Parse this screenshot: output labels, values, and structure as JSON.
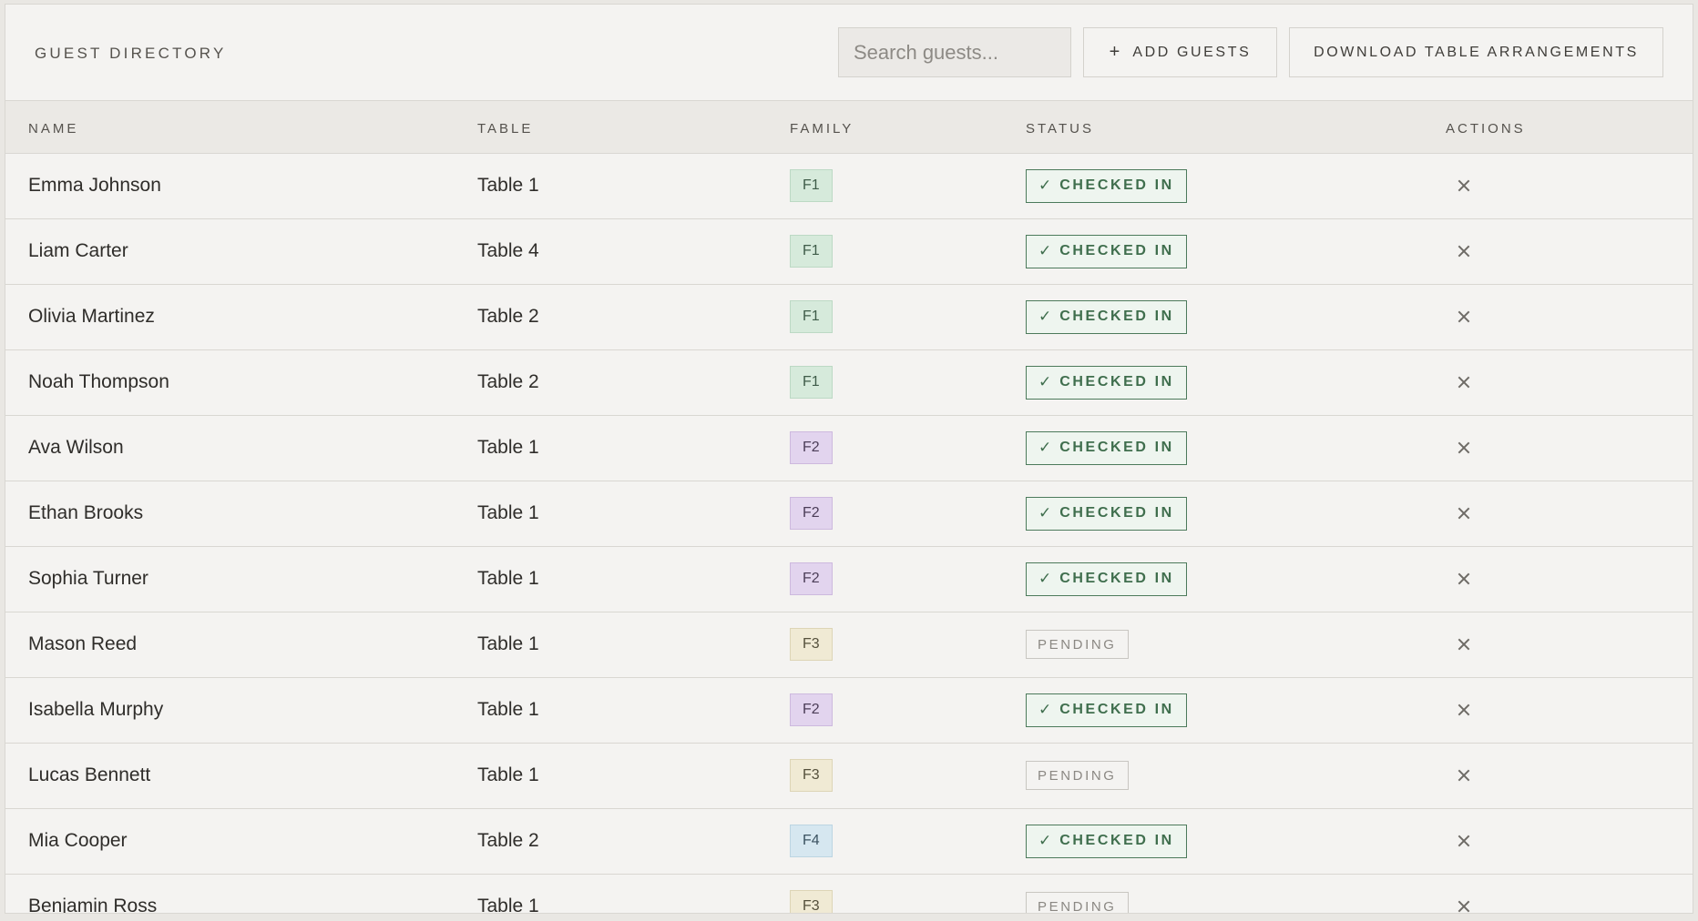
{
  "header": {
    "title": "GUEST DIRECTORY",
    "search_placeholder": "Search guests...",
    "add_label": "ADD GUESTS",
    "add_icon": "+",
    "download_label": "DOWNLOAD TABLE ARRANGEMENTS"
  },
  "columns": {
    "name": "NAME",
    "table": "TABLE",
    "family": "FAMILY",
    "status": "STATUS",
    "actions": "ACTIONS"
  },
  "status_labels": {
    "checked_in": "CHECKED IN",
    "pending": "PENDING",
    "check_icon": "✓"
  },
  "colors": {
    "F1": "#d6eadb",
    "F2": "#e2d4ee",
    "F3": "#f0ead4",
    "F4": "#d6e7f0",
    "checked_in": "#3f6e4d"
  },
  "guests": [
    {
      "name": "Emma Johnson",
      "table": "Table 1",
      "family": "F1",
      "status": "checked_in"
    },
    {
      "name": "Liam Carter",
      "table": "Table 4",
      "family": "F1",
      "status": "checked_in"
    },
    {
      "name": "Olivia Martinez",
      "table": "Table 2",
      "family": "F1",
      "status": "checked_in"
    },
    {
      "name": "Noah Thompson",
      "table": "Table 2",
      "family": "F1",
      "status": "checked_in"
    },
    {
      "name": "Ava Wilson",
      "table": "Table 1",
      "family": "F2",
      "status": "checked_in"
    },
    {
      "name": "Ethan Brooks",
      "table": "Table 1",
      "family": "F2",
      "status": "checked_in"
    },
    {
      "name": "Sophia Turner",
      "table": "Table 1",
      "family": "F2",
      "status": "checked_in"
    },
    {
      "name": "Mason Reed",
      "table": "Table 1",
      "family": "F3",
      "status": "pending"
    },
    {
      "name": "Isabella Murphy",
      "table": "Table 1",
      "family": "F2",
      "status": "checked_in"
    },
    {
      "name": "Lucas Bennett",
      "table": "Table 1",
      "family": "F3",
      "status": "pending"
    },
    {
      "name": "Mia Cooper",
      "table": "Table 2",
      "family": "F4",
      "status": "checked_in"
    },
    {
      "name": "Benjamin Ross",
      "table": "Table 1",
      "family": "F3",
      "status": "pending"
    }
  ]
}
